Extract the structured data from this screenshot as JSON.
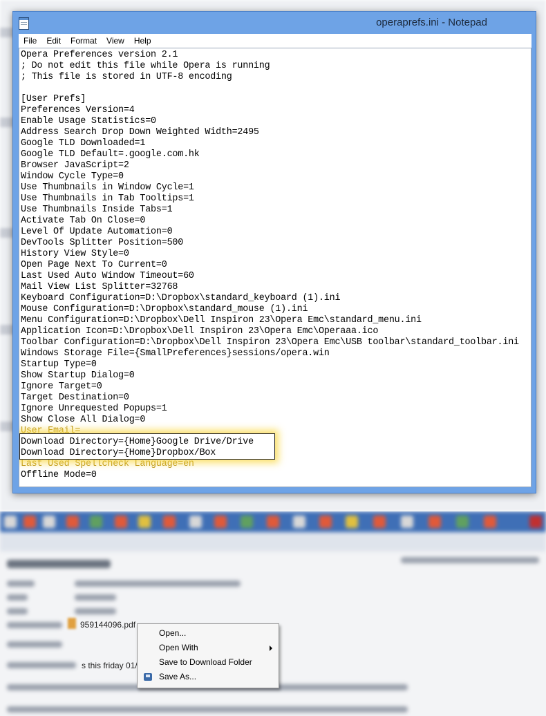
{
  "notepad": {
    "title": "operaprefs.ini - Notepad",
    "menu": [
      "File",
      "Edit",
      "Format",
      "View",
      "Help"
    ],
    "lines": [
      "Opera Preferences version 2.1",
      "; Do not edit this file while Opera is running",
      "; This file is stored in UTF-8 encoding",
      "",
      "[User Prefs]",
      "Preferences Version=4",
      "Enable Usage Statistics=0",
      "Address Search Drop Down Weighted Width=2495",
      "Google TLD Downloaded=1",
      "Google TLD Default=.google.com.hk",
      "Browser JavaScript=2",
      "Window Cycle Type=0",
      "Use Thumbnails in Window Cycle=1",
      "Use Thumbnails in Tab Tooltips=1",
      "Use Thumbnails Inside Tabs=1",
      "Activate Tab On Close=0",
      "Level Of Update Automation=0",
      "DevTools Splitter Position=500",
      "History View Style=0",
      "Open Page Next To Current=0",
      "Last Used Auto Window Timeout=60",
      "Mail View List Splitter=32768",
      "Keyboard Configuration=D:\\Dropbox\\standard_keyboard (1).ini",
      "Mouse Configuration=D:\\Dropbox\\standard_mouse (1).ini",
      "Menu Configuration=D:\\Dropbox\\Dell Inspiron 23\\Opera Emc\\standard_menu.ini",
      "Application Icon=D:\\Dropbox\\Dell Inspiron 23\\Opera Emc\\Operaaa.ico",
      "Toolbar Configuration=D:\\Dropbox\\Dell Inspiron 23\\Opera Emc\\USB toolbar\\standard_toolbar.ini",
      "Windows Storage File={SmallPreferences}sessions/opera.win",
      "Startup Type=0",
      "Show Startup Dialog=0",
      "Ignore Target=0",
      "Target Destination=0",
      "Ignore Unrequested Popups=1",
      "Show Close All Dialog=0",
      "User Email=",
      "Download Directory={Home}Google Drive/Drive",
      "Download Directory={Home}Dropbox/Box",
      "Last Used Spellcheck Language=en",
      "Offline Mode=0"
    ],
    "highlighted_lines": [
      35,
      36
    ],
    "dimmed_lines": [
      34,
      37
    ],
    "highlight_color": "#fad73c"
  },
  "email": {
    "attachment_name": "959144096.pdf",
    "snippet": "s this friday 01/0",
    "toolbar_color": "#3f6fb6"
  },
  "context_menu": {
    "items": [
      {
        "label": "Open...",
        "icon": null,
        "submenu": false
      },
      {
        "label": "Open With",
        "icon": null,
        "submenu": true
      },
      {
        "label": "Save to Download Folder",
        "icon": null,
        "submenu": false
      },
      {
        "label": "Save As...",
        "icon": "save-icon",
        "submenu": false
      }
    ]
  }
}
